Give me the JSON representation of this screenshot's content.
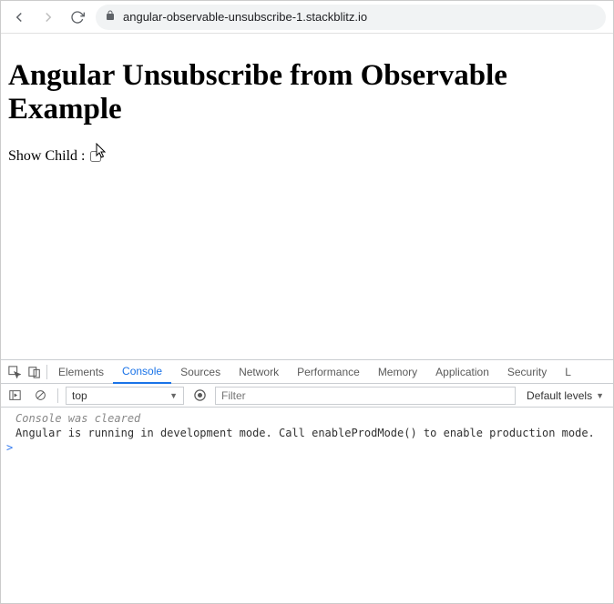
{
  "browser": {
    "url": "angular-observable-unsubscribe-1.stackblitz.io"
  },
  "page": {
    "heading": "Angular Unsubscribe from Observable Example",
    "showChildLabel": "Show Child :"
  },
  "devtools": {
    "tabs": {
      "elements": "Elements",
      "console": "Console",
      "sources": "Sources",
      "network": "Network",
      "performance": "Performance",
      "memory": "Memory",
      "application": "Application",
      "security": "Security",
      "more": "L"
    },
    "toolbar": {
      "context": "top",
      "filterPlaceholder": "Filter",
      "levels": "Default levels"
    },
    "console": {
      "cleared": "Console was cleared",
      "msg1": "Angular is running in development mode. Call enableProdMode() to enable production mode.",
      "prompt": ">"
    }
  }
}
